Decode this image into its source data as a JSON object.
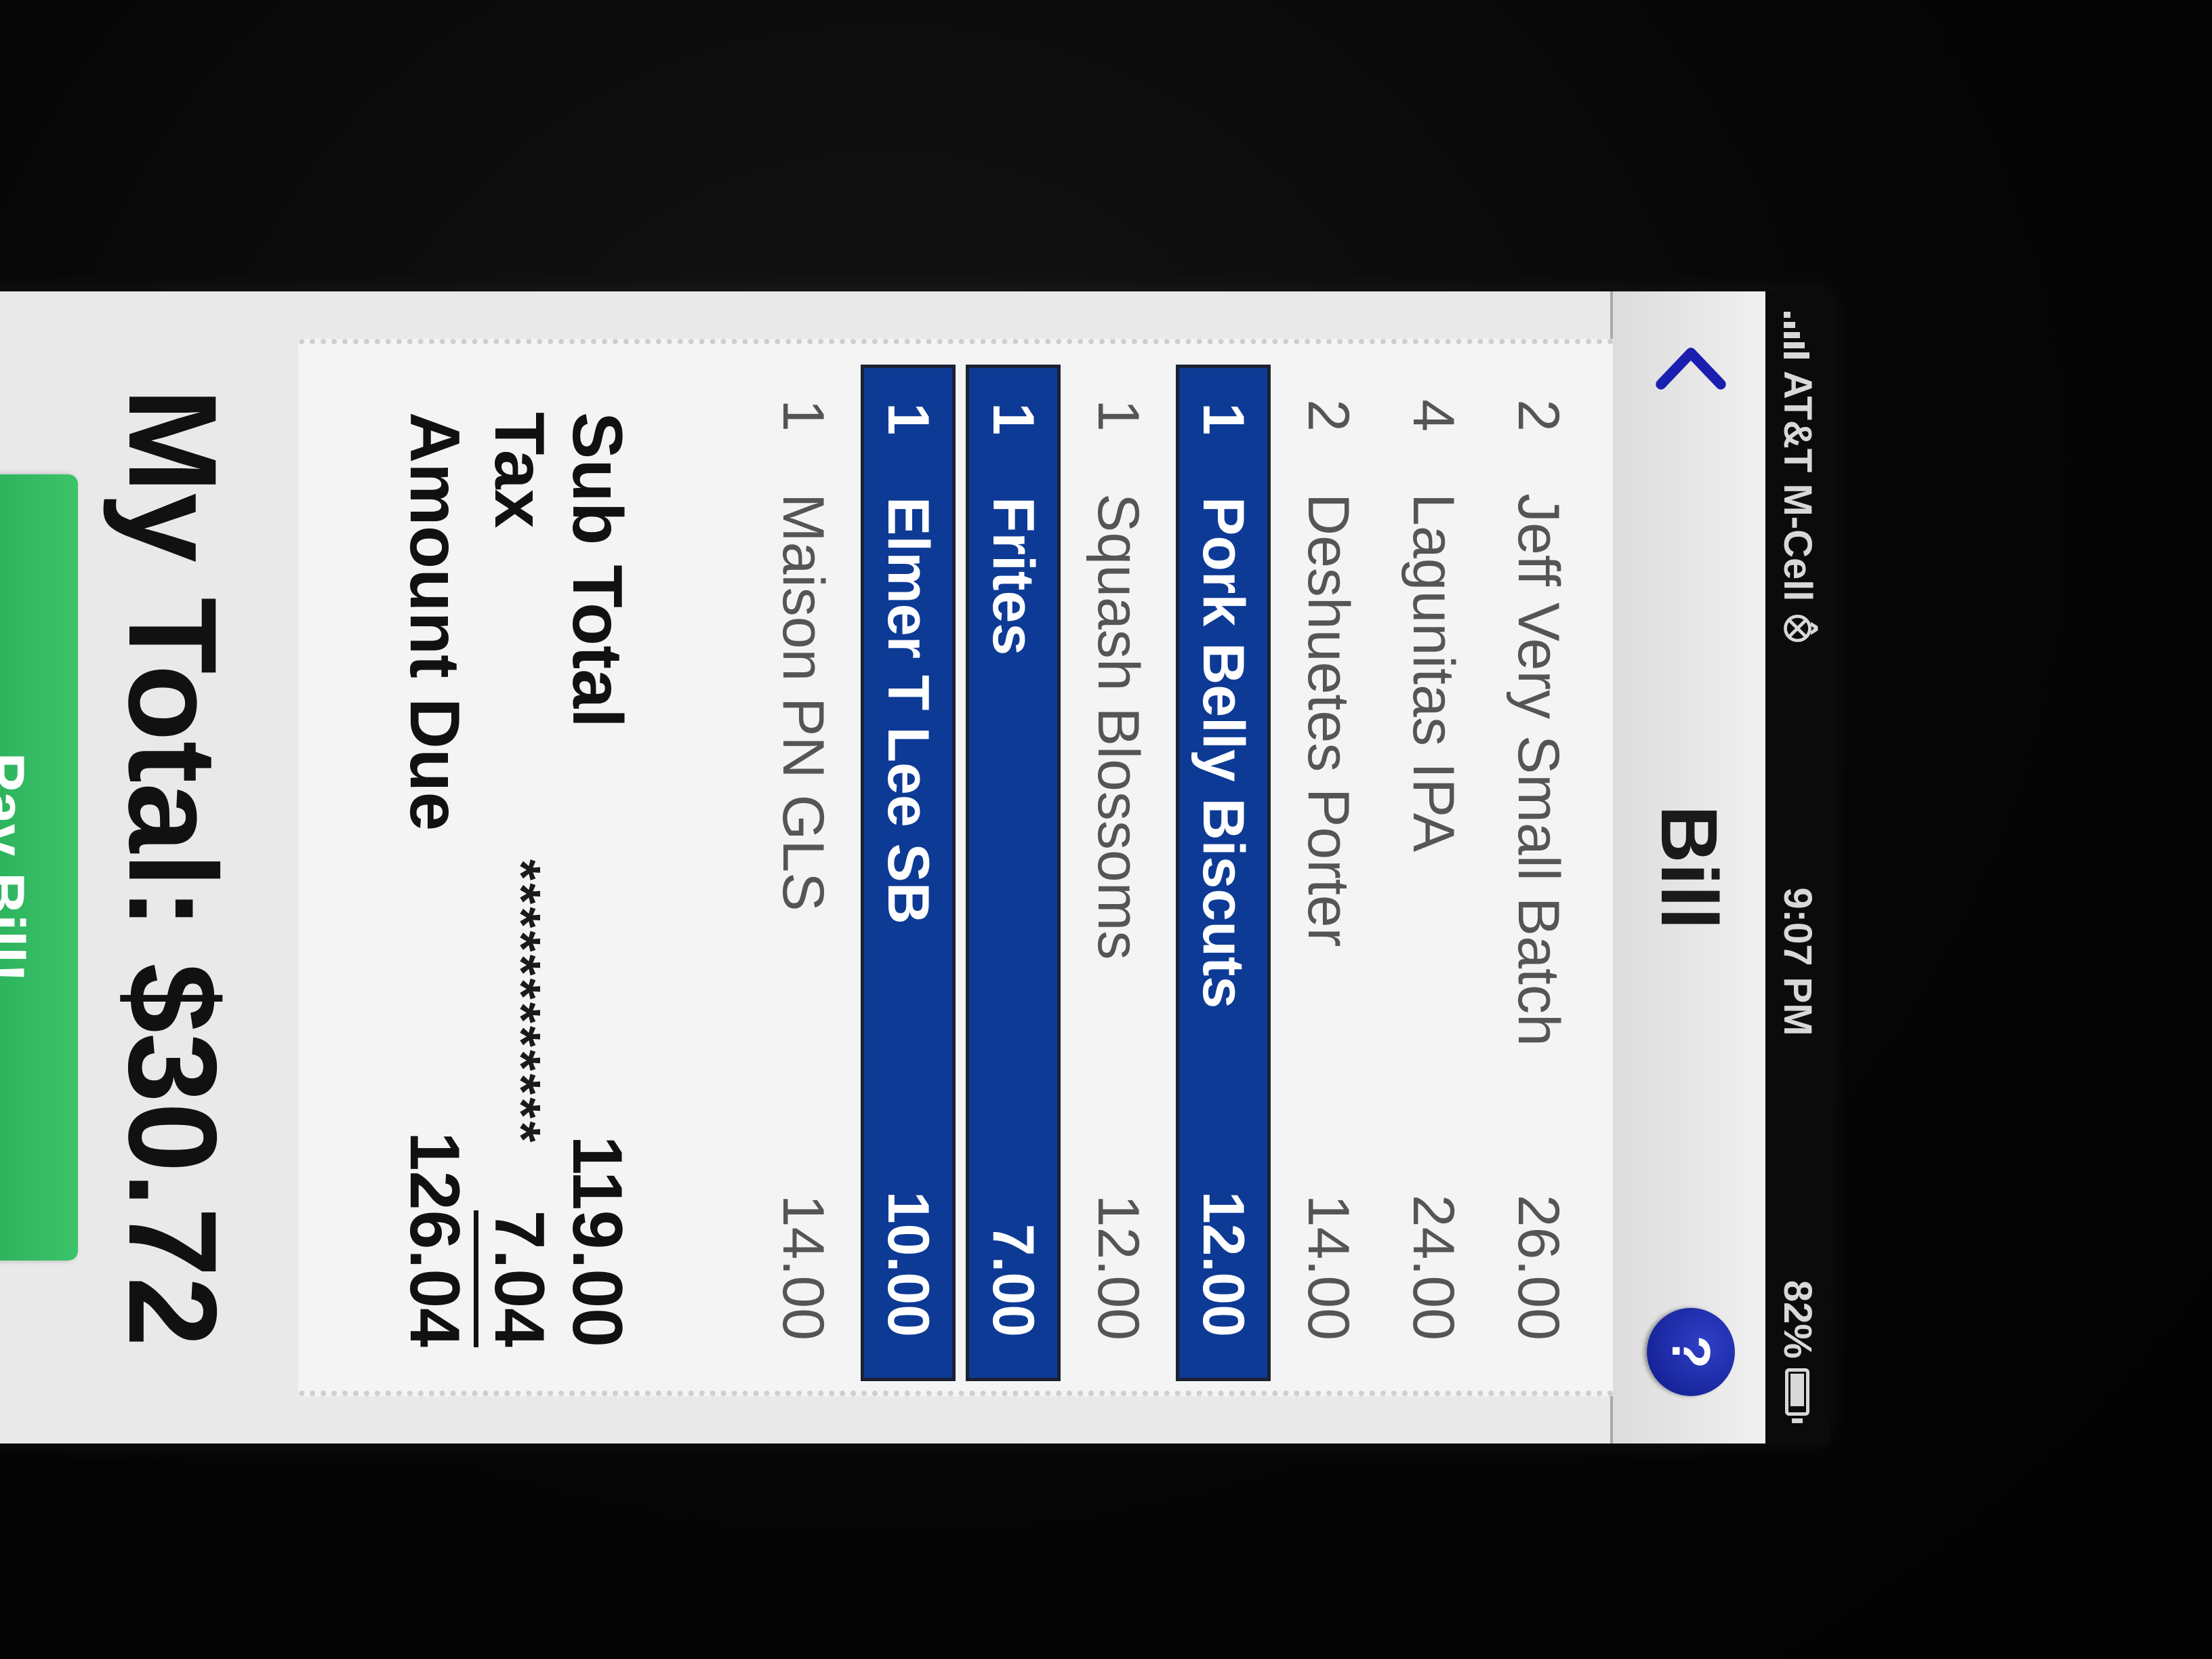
{
  "status_bar": {
    "carrier": "AT&T M-Cell",
    "time": "9:07 PM",
    "battery": "82%"
  },
  "nav": {
    "title": "Bill",
    "help_label": "?"
  },
  "items": [
    {
      "qty": "2",
      "name": "Jeff Very Small Batch",
      "price": "26.00",
      "selected": false
    },
    {
      "qty": "4",
      "name": "Lagunitas IPA",
      "price": "24.00",
      "selected": false
    },
    {
      "qty": "2",
      "name": "Deshuetes Porter",
      "price": "14.00",
      "selected": false
    },
    {
      "qty": "1",
      "name": "Pork Belly Biscuts",
      "price": "12.00",
      "selected": true
    },
    {
      "qty": "1",
      "name": "Squash Blossoms",
      "price": "12.00",
      "selected": false
    },
    {
      "qty": "1",
      "name": "Frites",
      "price": "7.00",
      "selected": true
    },
    {
      "qty": "1",
      "name": "Elmer T Lee SB",
      "price": "10.00",
      "selected": true
    },
    {
      "qty": "1",
      "name": "Maison PN GLS",
      "price": "14.00",
      "selected": false
    }
  ],
  "separator": "************",
  "totals": {
    "subtotal_label": "Sub Total",
    "subtotal_value": "119.00",
    "tax_label": "Tax",
    "tax_value": "7.04",
    "amount_due_label": "Amount Due",
    "amount_due_value": "126.04"
  },
  "my_total": {
    "label": "My Total:",
    "value": "$30.72"
  },
  "pay_button_label": "Pay Bill!"
}
